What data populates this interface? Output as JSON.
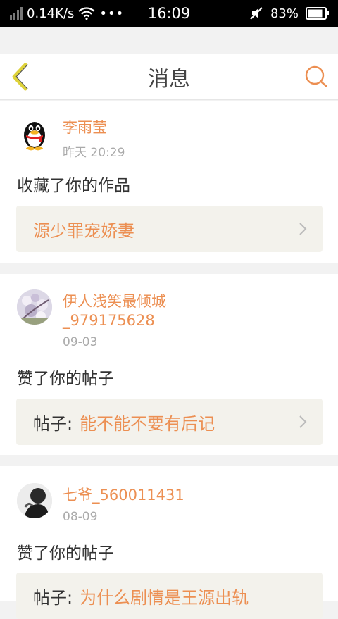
{
  "status_bar": {
    "speed": "0.14K/s",
    "dots": "•••",
    "time": "16:09",
    "battery": "83%"
  },
  "header": {
    "title": "消息",
    "back_icon": "chevron-left-icon",
    "search_icon": "search-icon"
  },
  "colors": {
    "accent": "#ec8f52",
    "back_icon": "#ded23a",
    "card_target_bg": "#f3f2ec",
    "page_bg": "#f2f2f2"
  },
  "messages": [
    {
      "user": "李雨莹",
      "time": "昨天 20:29",
      "action": "收藏了你的作品",
      "target_prefix": "",
      "target": "源少罪宠娇妻"
    },
    {
      "user_line1": "伊人浅笑最倾城",
      "user_line2": "_979175628",
      "time": "09-03",
      "action": "赞了你的帖子",
      "target_prefix": "帖子:",
      "target": "能不能不要有后记"
    },
    {
      "user": "七爷_560011431",
      "time": "08-09",
      "action": "赞了你的帖子",
      "target_prefix": "帖子:",
      "target": "为什么剧情是王源出轨"
    }
  ]
}
